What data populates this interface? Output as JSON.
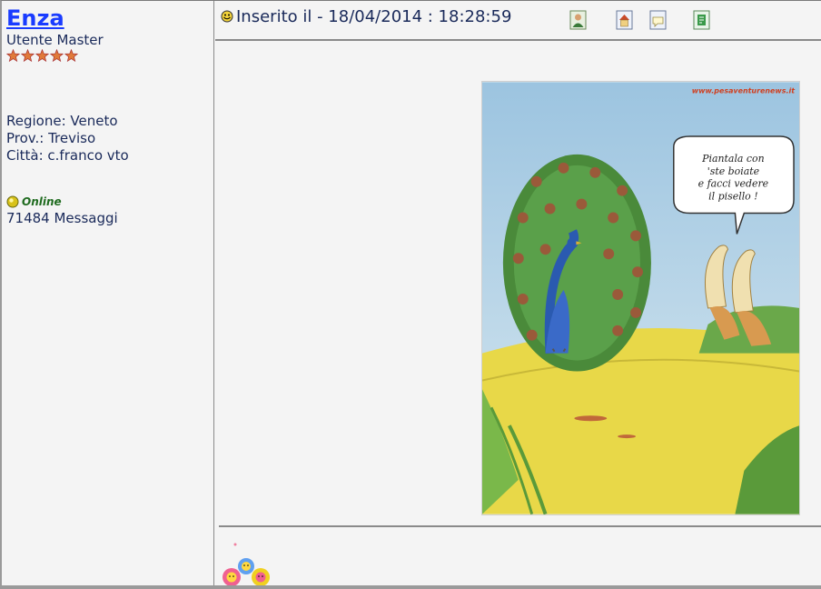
{
  "author": {
    "name": "Enza",
    "rank": "Utente Master",
    "stars": 5,
    "region": "Regione: Veneto",
    "province": "Prov.: Treviso",
    "city": "Città: c.franco vto",
    "status": "Online",
    "messages": "71484 Messaggi"
  },
  "post": {
    "posted_label": "Inserito il - 18/04/2014 : 18:28:59",
    "icons": [
      "profile-icon",
      "homepage-icon",
      "quote-icon",
      "edit-icon"
    ],
    "image_text": {
      "watermark": "www.pesaventurenews.it",
      "speech": [
        "Piantala con",
        "'ste boiate",
        "e facci vedere",
        "il pisello !"
      ]
    }
  },
  "colors": {
    "author_link": "#1a3cff",
    "text": "#1a2a5a",
    "online": "#1f6b1f",
    "background": "#f4f4f4",
    "star": "#e07a3a"
  }
}
